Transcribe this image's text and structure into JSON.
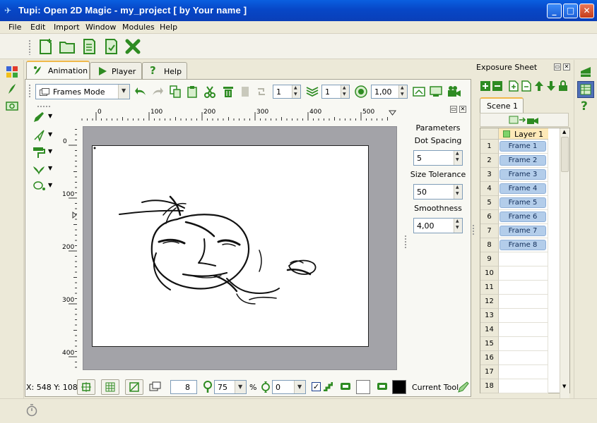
{
  "window": {
    "title": "Tupi: Open 2D Magic - my_project [ by Your name ]",
    "minimize_label": "_",
    "maximize_label": "□",
    "close_label": "✕"
  },
  "menu": [
    "File",
    "Edit",
    "Import",
    "Window",
    "Modules",
    "Help"
  ],
  "tabs": [
    {
      "label": "Animation",
      "icon": "animation-icon",
      "active": true
    },
    {
      "label": "Player",
      "icon": "play-icon",
      "active": false
    },
    {
      "label": "Help",
      "icon": "help-icon",
      "active": false
    }
  ],
  "anim_toolbar": {
    "mode": "Frames Mode",
    "spin1": "1",
    "spin2": "1",
    "zoom_value": "1,00"
  },
  "rulers": {
    "h": [
      "0",
      "100",
      "200",
      "300",
      "400",
      "500"
    ],
    "v": [
      "0",
      "100",
      "200",
      "300",
      "400"
    ]
  },
  "params": {
    "title": "Parameters",
    "dot_spacing_label": "Dot Spacing",
    "dot_spacing": "5",
    "size_tolerance_label": "Size Tolerance",
    "size_tolerance": "50",
    "smoothness_label": "Smoothness",
    "smoothness": "4,00"
  },
  "status": {
    "coords": "X: 548 Y: 108",
    "brush_size": "8",
    "zoom": "75",
    "percent": "%",
    "rotation": "0",
    "current_tool": "Current Tool"
  },
  "exposure": {
    "title": "Exposure Sheet",
    "scene_tab": "Scene 1",
    "layer": "Layer 1",
    "rows": [
      {
        "n": "1",
        "frame": "Frame 1"
      },
      {
        "n": "2",
        "frame": "Frame 2"
      },
      {
        "n": "3",
        "frame": "Frame 3"
      },
      {
        "n": "4",
        "frame": "Frame 4"
      },
      {
        "n": "5",
        "frame": "Frame 5"
      },
      {
        "n": "6",
        "frame": "Frame 6"
      },
      {
        "n": "7",
        "frame": "Frame 7"
      },
      {
        "n": "8",
        "frame": "Frame 8"
      },
      {
        "n": "9",
        "frame": ""
      },
      {
        "n": "10",
        "frame": ""
      },
      {
        "n": "11",
        "frame": ""
      },
      {
        "n": "12",
        "frame": ""
      },
      {
        "n": "13",
        "frame": ""
      },
      {
        "n": "14",
        "frame": ""
      },
      {
        "n": "15",
        "frame": ""
      },
      {
        "n": "16",
        "frame": ""
      },
      {
        "n": "17",
        "frame": ""
      },
      {
        "n": "18",
        "frame": ""
      }
    ]
  },
  "colors": {
    "accent_green": "#2e8b22",
    "title_blue": "#0747c7",
    "frame_blue": "#b3cdea",
    "tab_highlight": "#f0b84a"
  }
}
